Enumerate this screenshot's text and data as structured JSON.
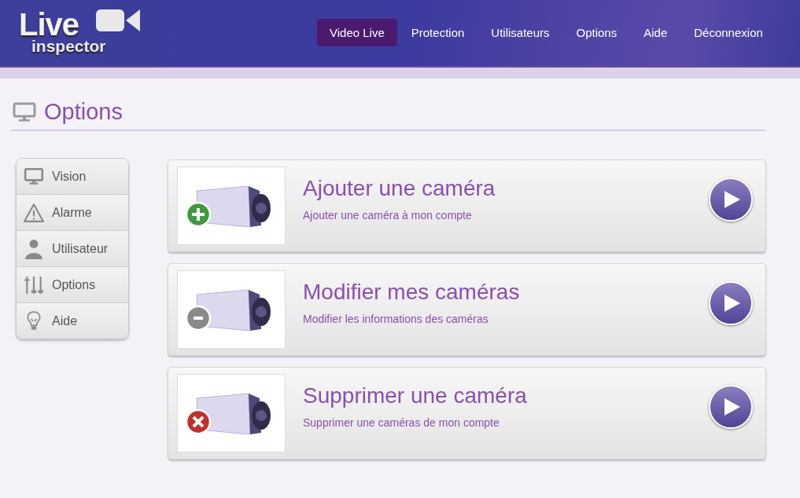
{
  "logo": {
    "line_1": "Live",
    "line_2": "inspector"
  },
  "nav": [
    {
      "label": "Video Live",
      "selected": true
    },
    {
      "label": "Protection",
      "selected": false
    },
    {
      "label": "Utilisateurs",
      "selected": false
    },
    {
      "label": "Options",
      "selected": false
    },
    {
      "label": "Aide",
      "selected": false
    },
    {
      "label": "Déconnexion",
      "selected": false
    }
  ],
  "page_title": "Options",
  "sidebar": [
    {
      "label": "Vision",
      "kind": "monitor"
    },
    {
      "label": "Alarme",
      "kind": "warning"
    },
    {
      "label": "Utilisateur",
      "kind": "user"
    },
    {
      "label": "Options",
      "kind": "sliders"
    },
    {
      "label": "Aide",
      "kind": "bulb"
    }
  ],
  "cards": [
    {
      "title": "Ajouter une caméra",
      "subtitle": "Ajouter une caméra à mon compte",
      "kind": "add"
    },
    {
      "title": "Modifier mes caméras",
      "subtitle": "Modifier les informations des caméras",
      "kind": "edit"
    },
    {
      "title": "Supprimer une caméra",
      "subtitle": "Supprimer une caméras de mon compte",
      "kind": "delete"
    }
  ]
}
